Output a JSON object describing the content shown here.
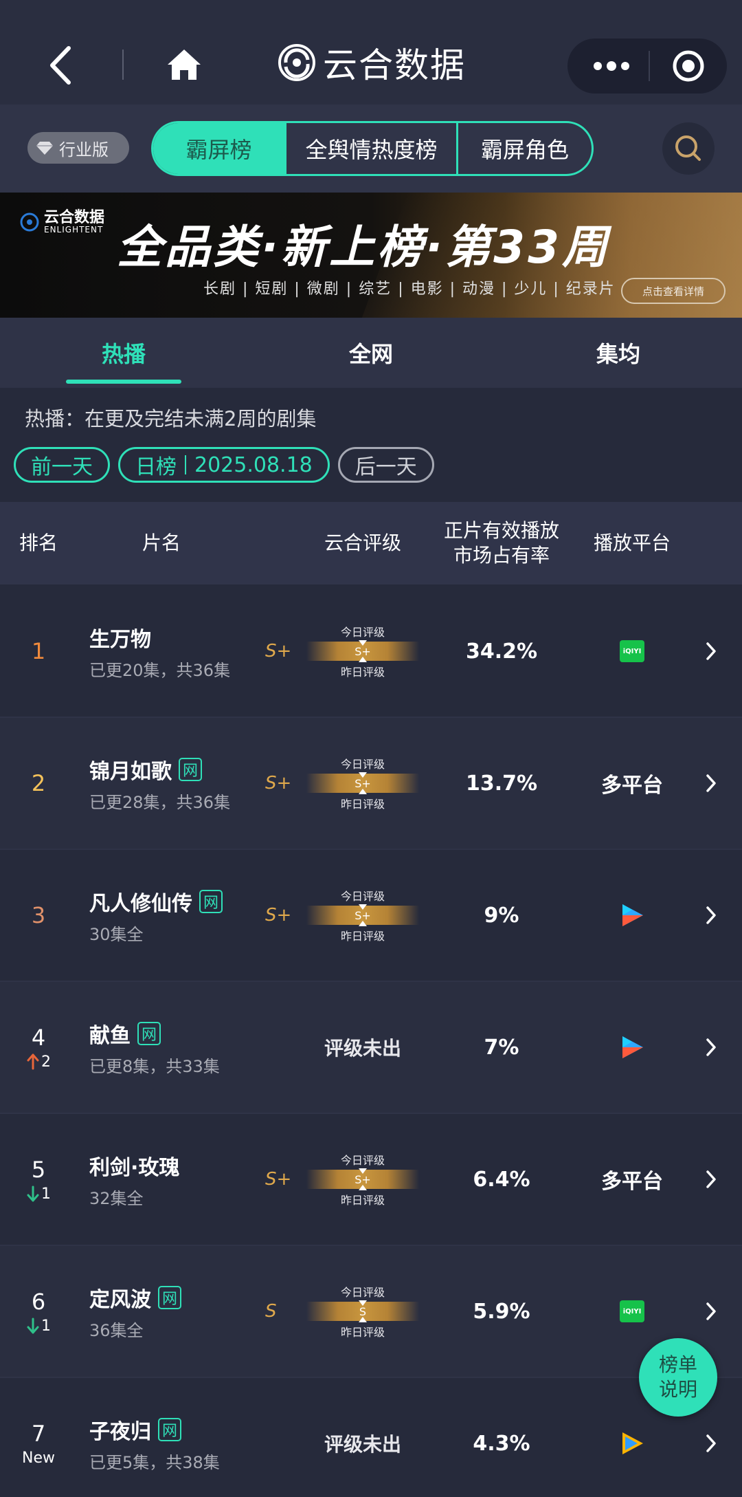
{
  "nav": {
    "brand_name": "云合数据"
  },
  "filter": {
    "industry_label": "行业版",
    "segments": [
      "霸屏榜",
      "全舆情热度榜",
      "霸屏角色"
    ]
  },
  "banner": {
    "logo_cn": "云合数据",
    "logo_en": "ENLIGHTENT",
    "title": "全品类·新上榜·第33周",
    "subtitle": "长剧 | 短剧 | 微剧 | 综艺 | 电影 | 动漫 | 少儿 | 纪录片",
    "detail_button": "点击查看详情"
  },
  "tabs": [
    "热播",
    "全网",
    "集均"
  ],
  "note": "热播：在更及完结未满2周的剧集",
  "date_bar": {
    "prev": "前一天",
    "type": "日榜",
    "date": "2025.08.18",
    "next": "后一天"
  },
  "table": {
    "headers": {
      "rank": "排名",
      "title": "片名",
      "grade": "云合评级",
      "share_line1": "正片有效播放",
      "share_line2": "市场占有率",
      "platform": "播放平台"
    },
    "rating_today": "今日评级",
    "rating_yesterday": "昨日评级",
    "wang_badge": "网",
    "rows": [
      {
        "rank": "1",
        "change": "",
        "title": "生万物",
        "episodes": "已更20集，共36集",
        "grade": "S+",
        "grade_today": "S+",
        "share": "34.2%",
        "platform": "",
        "platform_icon": "iqiyi-icon"
      },
      {
        "rank": "2",
        "change": "",
        "title": "锦月如歌",
        "episodes": "已更28集，共36集",
        "grade": "S+",
        "grade_today": "S+",
        "share": "13.7%",
        "platform": "多平台",
        "platform_icon": ""
      },
      {
        "rank": "3",
        "change": "",
        "title": "凡人修仙传",
        "episodes": "30集全",
        "grade": "S+",
        "grade_today": "S+",
        "share": "9%",
        "platform": "",
        "platform_icon": "youku-icon"
      },
      {
        "rank": "4",
        "change": "2",
        "title": "献鱼",
        "episodes": "已更8集，共33集",
        "grade": "",
        "grade_none": "评级未出",
        "share": "7%",
        "platform": "",
        "platform_icon": "youku-icon"
      },
      {
        "rank": "5",
        "change": "1",
        "title": "利剑·玫瑰",
        "episodes": "32集全",
        "grade": "S+",
        "grade_today": "S+",
        "share": "6.4%",
        "platform": "多平台",
        "platform_icon": ""
      },
      {
        "rank": "6",
        "change": "1",
        "title": "定风波",
        "episodes": "36集全",
        "grade": "S",
        "grade_today": "S",
        "share": "5.9%",
        "platform": "",
        "platform_icon": "iqiyi-icon"
      },
      {
        "rank": "7",
        "change": "New",
        "title": "子夜归",
        "episodes": "已更5集，共38集",
        "grade": "",
        "grade_none": "评级未出",
        "share": "4.3%",
        "platform": "",
        "platform_icon": "tencent-video-icon"
      }
    ]
  },
  "iqiyi_text": "iQIYI",
  "float_button": {
    "line1": "榜单",
    "line2": "说明"
  },
  "colors": {
    "accent": "#2fe0b8",
    "grade_gold": "#e0a94c",
    "rank_up": "#e8663a",
    "rank_down": "#2fc08a",
    "background": "#262a3b"
  }
}
